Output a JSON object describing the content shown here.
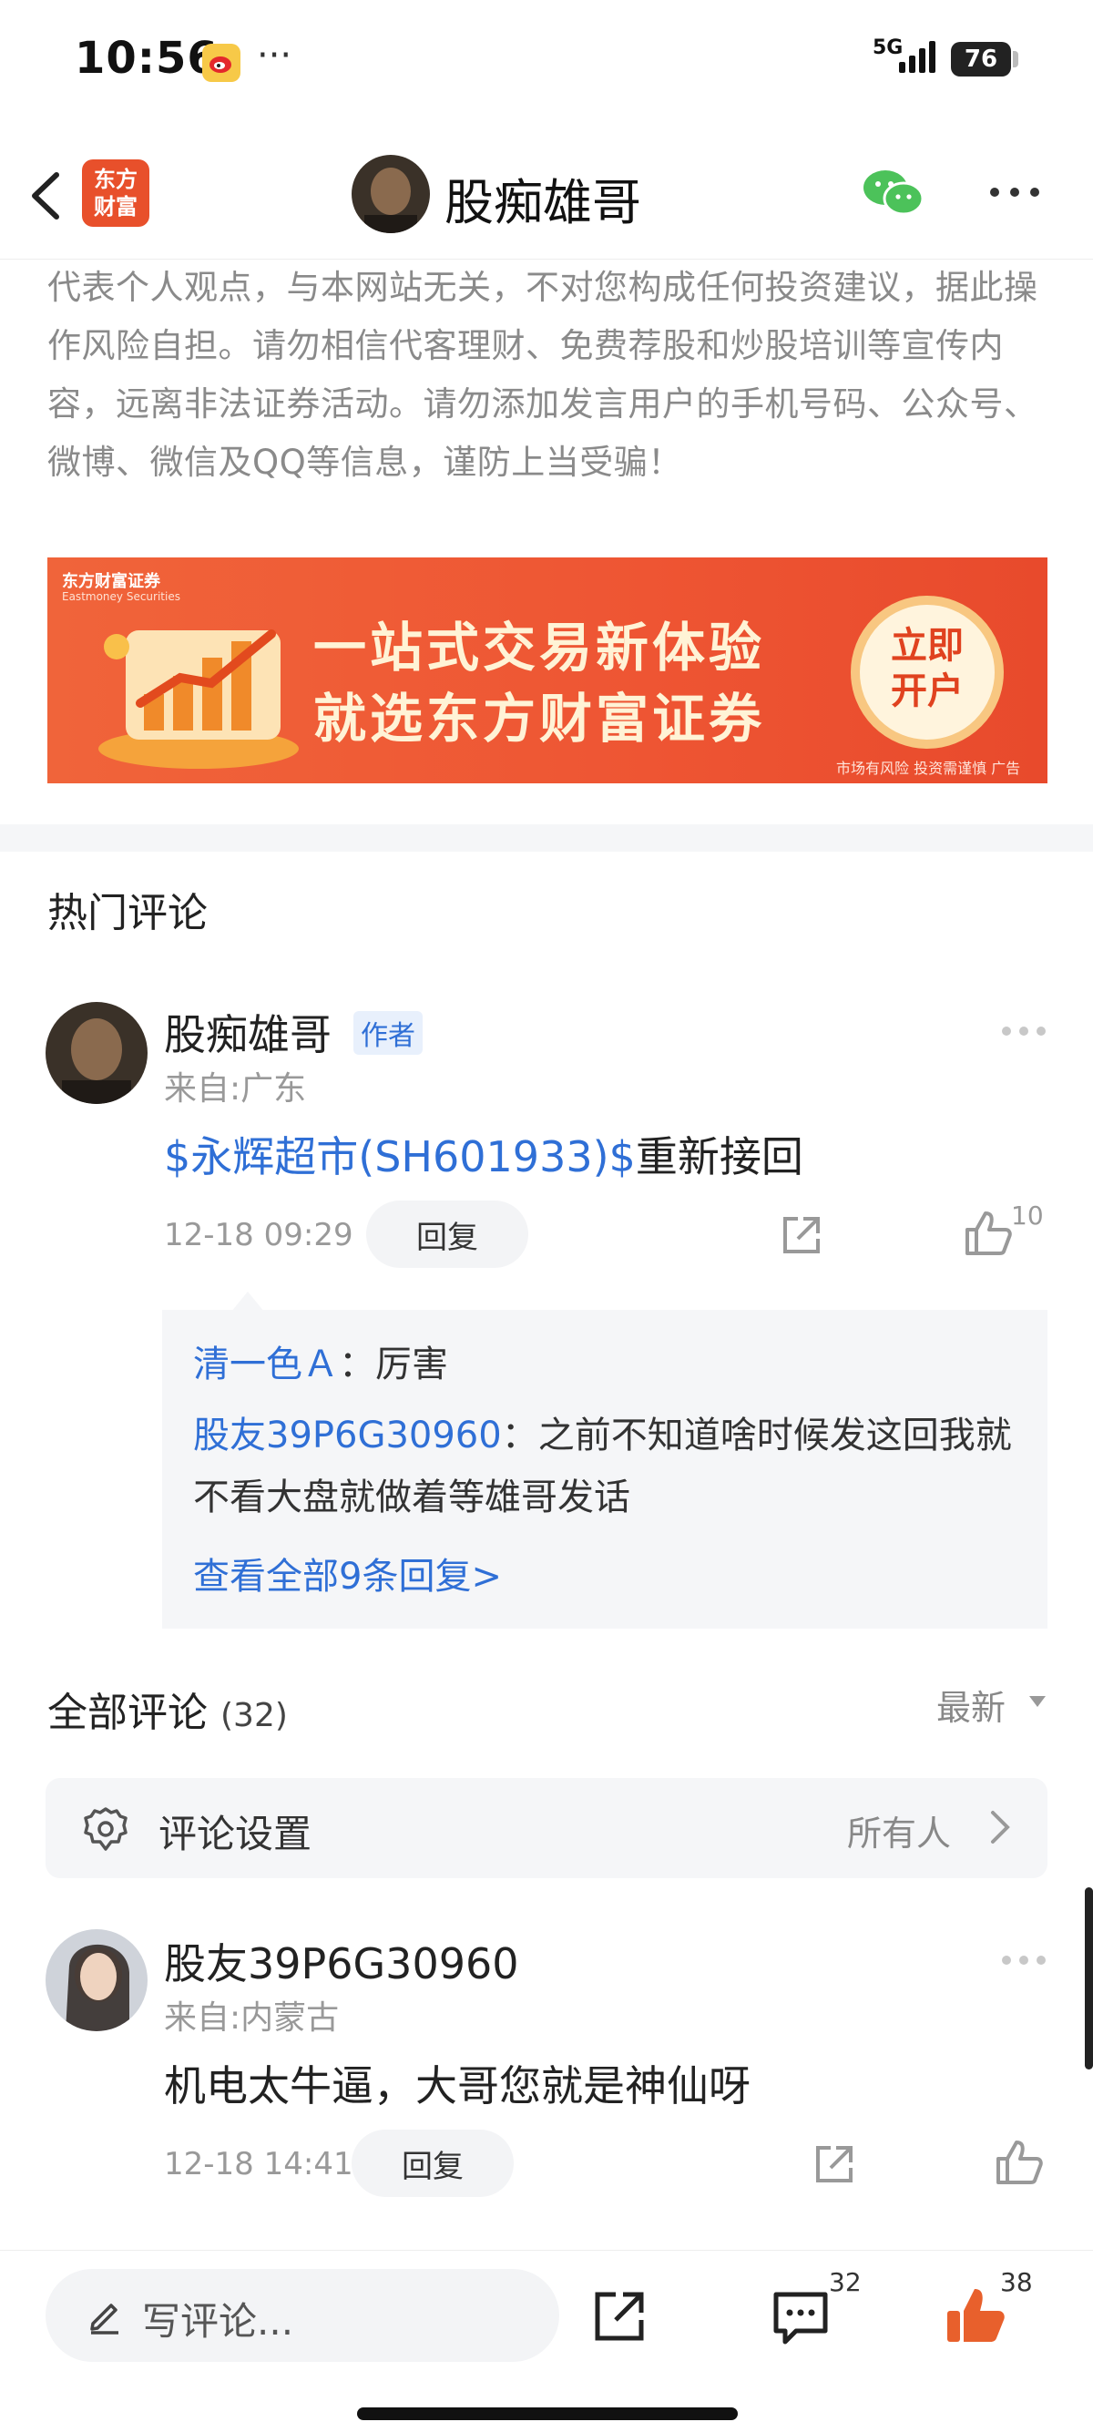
{
  "status_bar": {
    "time": "10:56",
    "dots": "···",
    "network": "5G",
    "battery": "76"
  },
  "header": {
    "title": "股痴雄哥",
    "brand_logo": "东方\n财富",
    "brand_logo_line1": "东方",
    "brand_logo_line2": "财富"
  },
  "disclaimer": "代表个人观点，与本网站无关，不对您构成任何投资建议，据此操作风险自担。请勿相信代客理财、免费荐股和炒股培训等宣传内容，远离非法证券活动。请勿添加发言用户的手机号码、公众号、微博、微信及QQ等信息，谨防上当受骗！",
  "ad": {
    "brand": "东方财富证券",
    "brand_en": "Eastmoney Securities",
    "line1": "一站式交易新体验",
    "line2": "就选东方财富证券",
    "cta_line1": "立即",
    "cta_line2": "开户",
    "note": "市场有风险 投资需谨慎 广告"
  },
  "hot_comments": {
    "title": "热门评论",
    "item": {
      "user": "股痴雄哥",
      "badge": "作者",
      "from": "来自:广东",
      "stock_link": "$永辉超市(SH601933)$",
      "text": "重新接回",
      "time": "12-18 09:29",
      "reply_label": "回复",
      "like_count": "10",
      "replies": [
        {
          "user": "清一色Ａ",
          "sep": "：",
          "text": "厉害"
        },
        {
          "user": "股友39P6G30960",
          "sep": "：",
          "text": "之前不知道啥时候发这回我就不看大盘就做着等雄哥发话"
        }
      ],
      "view_all": "查看全部9条回复>"
    }
  },
  "all_comments": {
    "title": "全部评论",
    "count": "(32)",
    "sort": "最新",
    "settings_label": "评论设置",
    "settings_value": "所有人",
    "items": [
      {
        "user": "股友39P6G30960",
        "from": "来自:内蒙古",
        "text": "机电太牛逼，大哥您就是神仙呀",
        "time": "12-18 14:41",
        "reply_label": "回复"
      }
    ]
  },
  "bottom_bar": {
    "placeholder": "写评论...",
    "comment_count": "32",
    "like_count": "38"
  },
  "colors": {
    "accent_blue": "#2f6fd6",
    "like_orange": "#e8602c",
    "brand_red": "#e8502b"
  }
}
